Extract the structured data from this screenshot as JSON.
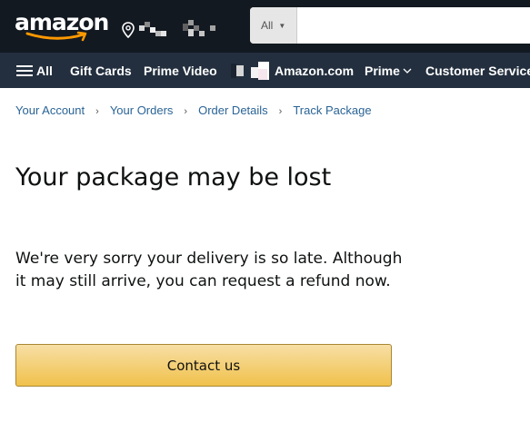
{
  "header": {
    "logo_text": "amazon",
    "search": {
      "category": "All",
      "value": "",
      "placeholder": ""
    }
  },
  "nav": {
    "all_label": "All",
    "items": [
      "Gift Cards",
      "Prime Video",
      "Amazon.com",
      "Prime",
      "Customer Service"
    ]
  },
  "breadcrumb": [
    "Your Account",
    "Your Orders",
    "Order Details",
    "Track Package"
  ],
  "main": {
    "title": "Your package may be lost",
    "message": "We're very sorry your delivery is so late. Although it may still arrive, you can request a refund now.",
    "contact_button": "Contact us"
  },
  "colors": {
    "header_bg": "#131921",
    "nav_bg": "#232f3e",
    "link": "#2a6496",
    "button_bg": "#f0c14b",
    "logo_arrow": "#ff9900"
  }
}
